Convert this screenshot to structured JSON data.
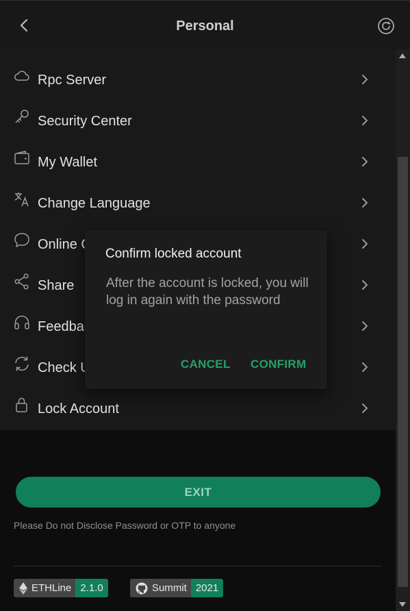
{
  "header": {
    "title": "Personal",
    "back_icon": "chevron-left-icon",
    "refresh_icon": "refresh-icon"
  },
  "menu": [
    {
      "label": "Rpc Server",
      "icon": "cloud-icon"
    },
    {
      "label": "Security Center",
      "icon": "key-icon"
    },
    {
      "label": "My Wallet",
      "icon": "wallet-icon"
    },
    {
      "label": "Change Language",
      "icon": "translate-icon"
    },
    {
      "label": "Online C",
      "icon": "chat-icon"
    },
    {
      "label": "Share",
      "icon": "share-icon"
    },
    {
      "label": "Feedbac",
      "icon": "headset-icon"
    },
    {
      "label": "Check U",
      "icon": "sync-icon"
    },
    {
      "label": "Lock Account",
      "icon": "lock-icon"
    }
  ],
  "dialog": {
    "title": "Confirm locked account",
    "message": "After the account is locked, you will log in again with the password",
    "cancel_label": "CANCEL",
    "confirm_label": "CONFIRM"
  },
  "exit_label": "EXIT",
  "notice": "Please Do not Disclose Password or OTP to anyone",
  "badges": [
    {
      "name": "ETHLine",
      "value": "2.1.0",
      "icon": "ethereum-icon"
    },
    {
      "name": "Summit",
      "value": "2021",
      "icon": "github-icon"
    }
  ],
  "colors": {
    "accent": "#11805a",
    "accent_text": "#26a06a",
    "background": "#0d0d0d",
    "panel": "#191919"
  }
}
